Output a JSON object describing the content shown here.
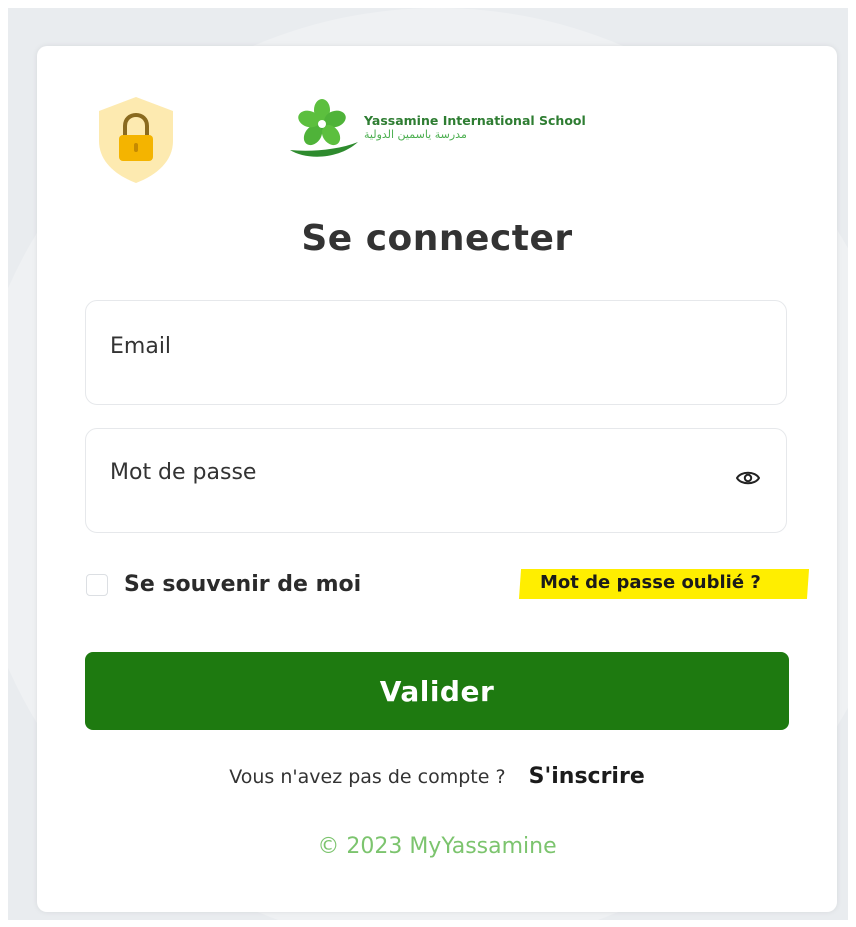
{
  "app": {
    "title": "Se connecter"
  },
  "branding": {
    "school_name": "Yassamine International School",
    "school_name_arabic": "مدرسة ياسمين الدولية",
    "logo_icon": "flower-logo-icon",
    "lock_icon": "lock-shield-icon",
    "brand_color": "#1e7a10"
  },
  "form": {
    "email_placeholder": "Email",
    "password_placeholder": "Mot de passe",
    "password_toggle_icon": "eye-icon",
    "remember_label": "Se souvenir de moi",
    "remember_checked": false,
    "forgot_label": "Mot de passe oublié ?",
    "forgot_highlight_color": "#ffee00",
    "submit_label": "Valider"
  },
  "signup": {
    "prompt": "Vous n'avez pas de compte ?",
    "link_label": "S'inscrire"
  },
  "footer": {
    "copyright": "© 2023 MyYassamine"
  }
}
